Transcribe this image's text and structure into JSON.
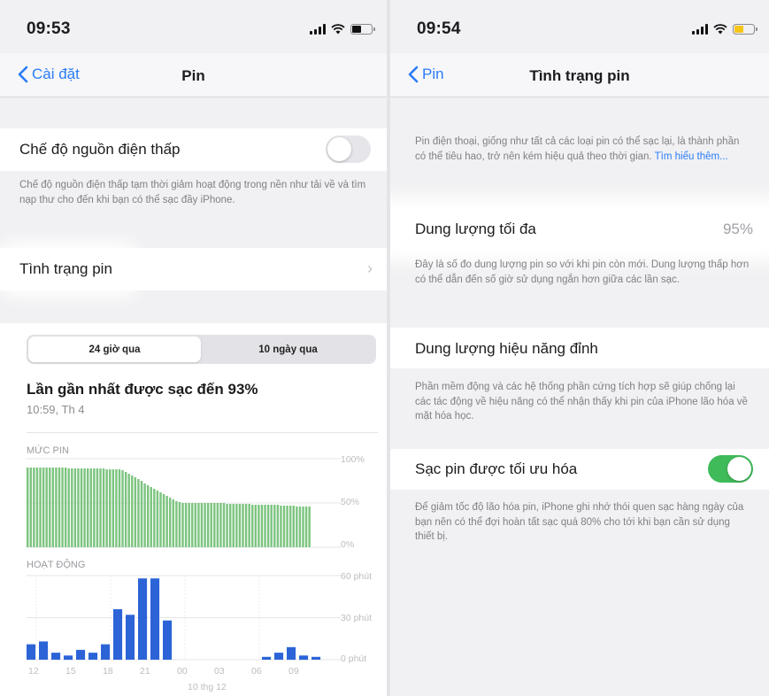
{
  "left": {
    "status": {
      "time": "09:53"
    },
    "nav": {
      "back_label": "Cài đặt",
      "title": "Pin"
    },
    "low_power": {
      "label": "Chế độ nguồn điện thấp",
      "enabled": false,
      "footer": "Chế độ nguồn điện thấp tạm thời giảm hoạt động trong nền như tải về và tìm nạp thư cho đến khi bạn có thể sạc đầy iPhone."
    },
    "battery_health_row": {
      "label": "Tình trạng pin",
      "chevron": "›"
    },
    "segmented": {
      "options": [
        "24 giờ qua",
        "10 ngày qua"
      ],
      "selected": "24 giờ qua"
    },
    "last_charged": {
      "title": "Lần gần nhất được sạc đến 93%",
      "time": "10:59, Th 4"
    }
  },
  "right": {
    "status": {
      "time": "09:54"
    },
    "nav": {
      "back_label": "Pin",
      "title": "Tình trạng pin"
    },
    "intro": {
      "text": "Pin điện thoại, giống như tất cả các loại pin có thể sạc lại, là thành phần có thể tiêu hao, trở nên kém hiệu quả theo thời gian.",
      "link": "Tìm hiểu thêm..."
    },
    "max_capacity": {
      "label": "Dung lượng tối đa",
      "value": "95%",
      "footer": "Đây là số đo dung lượng pin so với khi pin còn mới. Dung lượng thấp hơn có thể dẫn đến số giờ sử dụng ngắn hơn giữa các lần sạc."
    },
    "peak_performance": {
      "label": "Dung lượng hiệu năng đỉnh",
      "footer": "Phần mềm động và các hệ thống phần cứng tích hợp sẽ giúp chống lại các tác động về hiệu năng có thể nhận thấy khi pin của iPhone lão hóa về mặt hóa học."
    },
    "optimized": {
      "label": "Sạc pin được tối ưu hóa",
      "enabled": true,
      "footer": "Để giảm tốc độ lão hóa pin, iPhone ghi nhớ thói quen sạc hàng ngày của bạn nên có thể đợi hoàn tất sạc quá 80% cho tới khi bạn cần sử dụng thiết bị."
    }
  },
  "colors": {
    "accent_blue": "#2a7cf6",
    "battery_green": "#7cc47f",
    "activity_blue": "#2c64d8",
    "toggle_on": "#3fbb5a"
  },
  "chart_data": [
    {
      "type": "bar",
      "title": "MỨC PIN",
      "ytick_labels": [
        "100%",
        "50%",
        "0%"
      ],
      "ylim": [
        0,
        100
      ],
      "unit": "%",
      "values": [
        90,
        90,
        90,
        90,
        90,
        90,
        90,
        90,
        90,
        90,
        90,
        90,
        90,
        89,
        89,
        89,
        89,
        89,
        89,
        89,
        89,
        89,
        89,
        89,
        89,
        88,
        88,
        88,
        88,
        88,
        87,
        85,
        83,
        81,
        79,
        77,
        75,
        72,
        70,
        68,
        66,
        64,
        62,
        60,
        58,
        56,
        54,
        52,
        51,
        50,
        50,
        50,
        50,
        50,
        50,
        50,
        50,
        50,
        50,
        50,
        50,
        50,
        50,
        49,
        49,
        49,
        49,
        49,
        49,
        49,
        49,
        48,
        48,
        48,
        48,
        48,
        48,
        48,
        48,
        48,
        47,
        47,
        47,
        47,
        47,
        46,
        46,
        46,
        46,
        46
      ]
    },
    {
      "type": "bar",
      "title": "HOẠT ĐỘNG",
      "ytick_labels": [
        "60 phút",
        "30 phút",
        "0 phút"
      ],
      "ylim": [
        0,
        60
      ],
      "unit": "phút",
      "x_tick_labels": [
        "12",
        "15",
        "18",
        "21",
        "00",
        "03",
        "06",
        "09"
      ],
      "date_label": "10 thg 12",
      "values": [
        11,
        13,
        5,
        3,
        7,
        5,
        11,
        36,
        32,
        58,
        58,
        28,
        0,
        0,
        0,
        0,
        0,
        0,
        0,
        2,
        5,
        9,
        3,
        2
      ]
    }
  ]
}
